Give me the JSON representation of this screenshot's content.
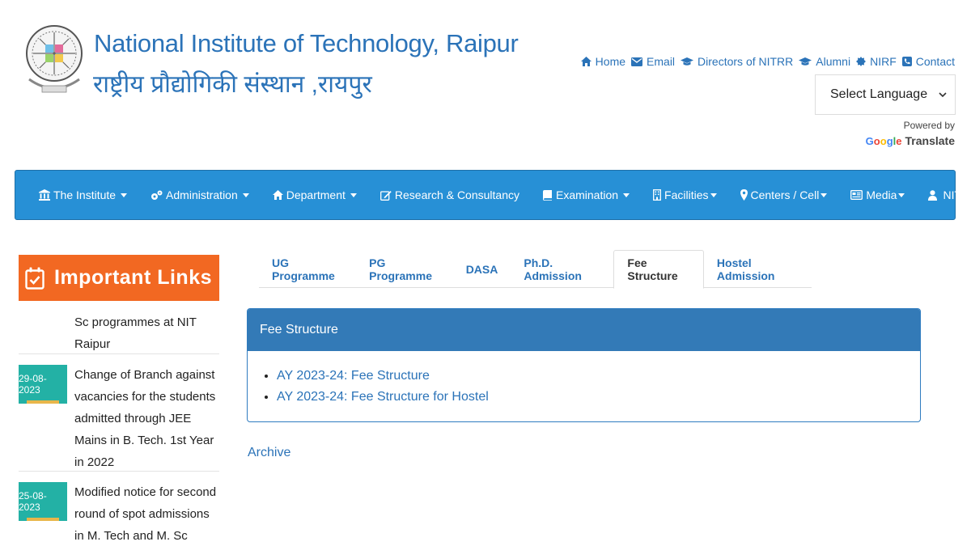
{
  "header": {
    "title_en": "National Institute of Technology, Raipur",
    "title_hi": "राष्ट्रीय प्रौद्योगिकी संस्थान ,रायपुर",
    "top_links": [
      {
        "label": "Home",
        "icon": "home-icon"
      },
      {
        "label": "Email",
        "icon": "envelope-icon"
      },
      {
        "label": "Directors of NITRR",
        "icon": "graduation-cap-icon"
      },
      {
        "label": "Alumni",
        "icon": "graduation-cap-icon"
      },
      {
        "label": "NIRF",
        "icon": "certificate-icon"
      },
      {
        "label": "Contact",
        "icon": "phone-icon"
      }
    ],
    "language_select": "Select Language",
    "powered_by": "Powered by",
    "google": "Google",
    "translate": "Translate"
  },
  "nav": {
    "items": [
      {
        "label": "The Institute",
        "icon": "institution-icon",
        "dropdown": true
      },
      {
        "label": "Administration",
        "icon": "cogs-icon",
        "dropdown": true
      },
      {
        "label": "Department",
        "icon": "home-icon",
        "dropdown": true
      },
      {
        "label": "Research & Consultancy",
        "icon": "edit-icon",
        "dropdown": false
      },
      {
        "label": "Examination",
        "icon": "book-icon",
        "dropdown": true
      },
      {
        "label": "Facilities",
        "icon": "building-icon",
        "dropdown": true
      },
      {
        "label": "Centers / Cell",
        "icon": "map-marker-icon",
        "dropdown": true
      },
      {
        "label": "Media",
        "icon": "newspaper-icon",
        "dropdown": true
      },
      {
        "label": "NITRRFIE",
        "icon": "user-icon",
        "dropdown": false
      }
    ]
  },
  "sidebar": {
    "heading": "Important Links",
    "items": [
      {
        "date": "",
        "text": "Sc programmes at NIT Raipur"
      },
      {
        "date": "29-08-2023",
        "text": "Change of Branch against vacancies for the students admitted through JEE Mains in B. Tech. 1st Year in 2022"
      },
      {
        "date": "25-08-2023",
        "text": "Modified notice for second round of spot admissions in M. Tech and M. Sc programmes at"
      }
    ]
  },
  "tabs": {
    "items": [
      "UG Programme",
      "PG Programme",
      "DASA",
      "Ph.D. Admission",
      "Fee Structure",
      "Hostel Admission"
    ],
    "active": "Fee Structure"
  },
  "panel": {
    "heading": "Fee Structure",
    "links": [
      "AY 2023-24: Fee Structure",
      "AY 2023-24: Fee Structure for Hostel"
    ]
  },
  "archive_label": "Archive",
  "colors": {
    "brand_blue": "#2b73b8",
    "navbar": "#2790d6",
    "important_links": "#f26822",
    "date_badge": "#23b1a5",
    "panel_head": "#337ab7"
  }
}
